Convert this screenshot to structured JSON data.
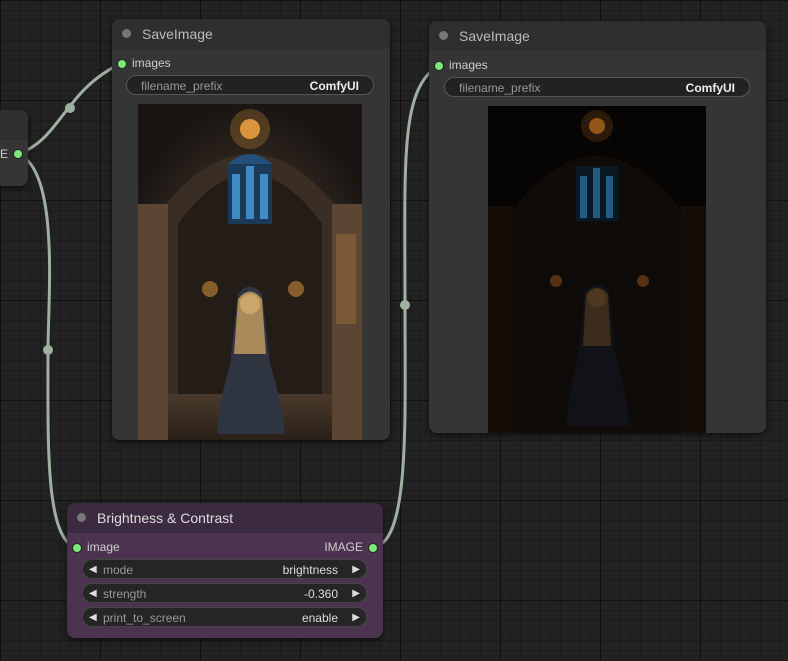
{
  "nodes": {
    "left_partial": {
      "output_label": "E"
    },
    "save_image_1": {
      "title": "SaveImage",
      "input_label": "images",
      "widget_label": "filename_prefix",
      "widget_value": "ComfyUI"
    },
    "save_image_2": {
      "title": "SaveImage",
      "input_label": "images",
      "widget_label": "filename_prefix",
      "widget_value": "ComfyUI"
    },
    "brightness_contrast": {
      "title": "Brightness & Contrast",
      "input_label": "image",
      "output_label": "IMAGE",
      "widgets": [
        {
          "label": "mode",
          "value": "brightness"
        },
        {
          "label": "strength",
          "value": "-0.360"
        },
        {
          "label": "print_to_screen",
          "value": "enable"
        }
      ]
    }
  },
  "colors": {
    "background": "#222222",
    "node": "#353535",
    "node_title": "#2f2f2f",
    "bc_node": "#4c3450",
    "slot_dot": "#7bea7b",
    "link": "#a0b0a0"
  }
}
